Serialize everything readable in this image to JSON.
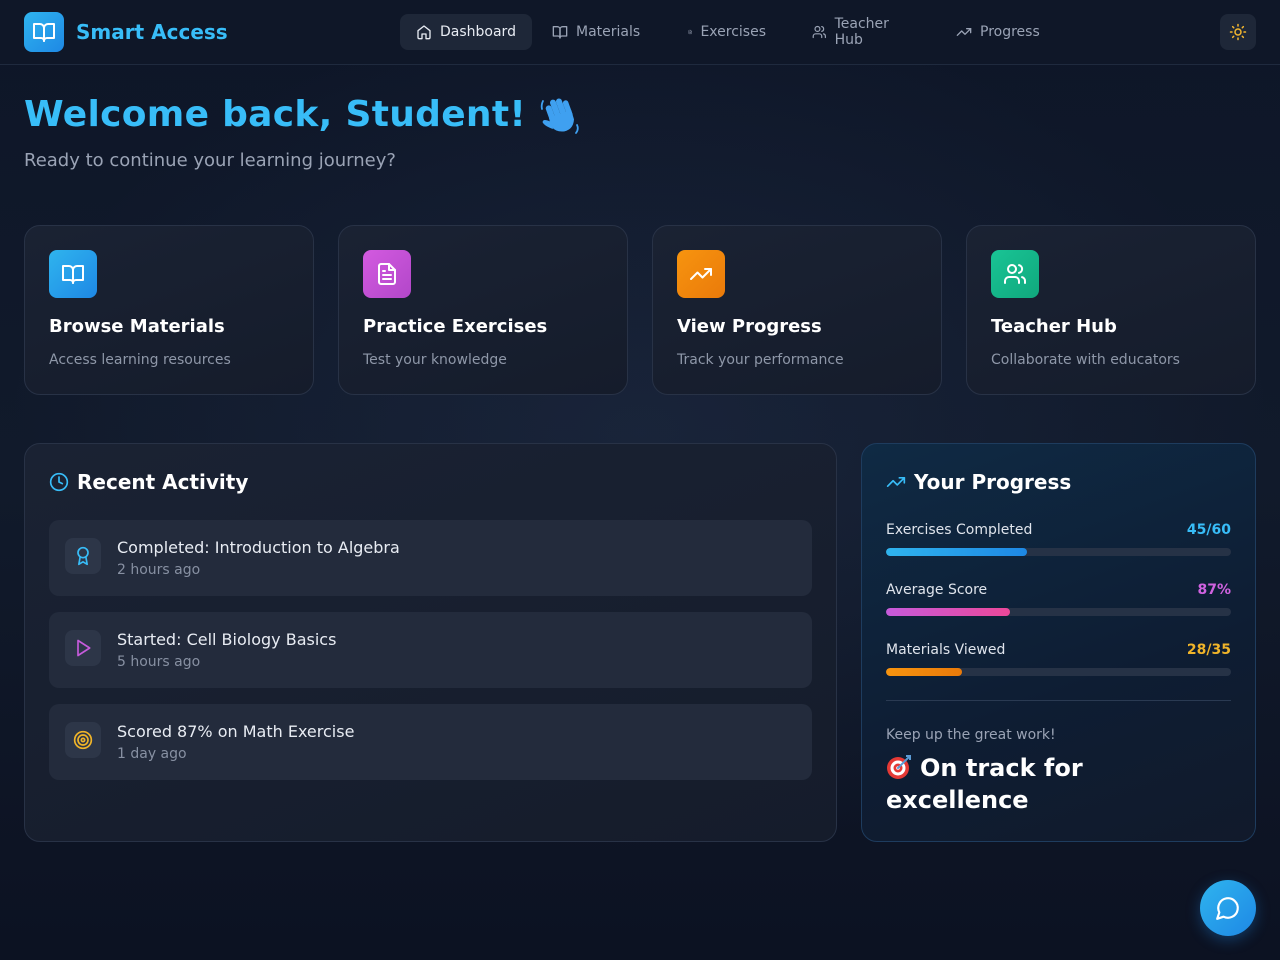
{
  "app": {
    "name": "Smart Access"
  },
  "nav": [
    {
      "label": "Dashboard",
      "icon": "home-icon",
      "active": true
    },
    {
      "label": "Materials",
      "icon": "book-open-icon"
    },
    {
      "label": "Exercises",
      "icon": "file-text-icon"
    },
    {
      "label": "Teacher Hub",
      "icon": "users-icon"
    },
    {
      "label": "Progress",
      "icon": "trending-up-icon"
    }
  ],
  "welcome": {
    "title": "Welcome back, Student!",
    "subtitle": "Ready to continue your learning journey?"
  },
  "cards": [
    {
      "title": "Browse Materials",
      "desc": "Access learning resources",
      "icon": "book-open-icon",
      "color": "#2ea7ea"
    },
    {
      "title": "Practice Exercises",
      "desc": "Test your knowledge",
      "icon": "file-text-icon",
      "color": "#c04fd6"
    },
    {
      "title": "View Progress",
      "desc": "Track your performance",
      "icon": "trending-up-icon",
      "color": "#f08a0c"
    },
    {
      "title": "Teacher Hub",
      "desc": "Collaborate with educators",
      "icon": "users-icon",
      "color": "#14b98c"
    }
  ],
  "activity": {
    "title": "Recent Activity",
    "items": [
      {
        "title": "Completed: Introduction to Algebra",
        "time": "2 hours ago",
        "icon": "award-icon"
      },
      {
        "title": "Started: Cell Biology Basics",
        "time": "5 hours ago",
        "icon": "play-icon"
      },
      {
        "title": "Scored 87% on Math Exercise",
        "time": "1 day ago",
        "icon": "target-icon"
      }
    ]
  },
  "progress": {
    "title": "Your Progress",
    "stats": [
      {
        "label": "Exercises Completed",
        "value": "45/60",
        "fraction": 0.41,
        "color": "#38bdf8"
      },
      {
        "label": "Average Score",
        "value": "87%",
        "fraction": 0.36,
        "color": "#d062e0"
      },
      {
        "label": "Materials Viewed",
        "value": "28/35",
        "fraction": 0.22,
        "color": "#f0b429"
      }
    ],
    "encouragement": "Keep up the great work!",
    "status": "On track for excellence"
  },
  "colors": {
    "accent": "#38bdf8",
    "background": "#0d1424"
  }
}
